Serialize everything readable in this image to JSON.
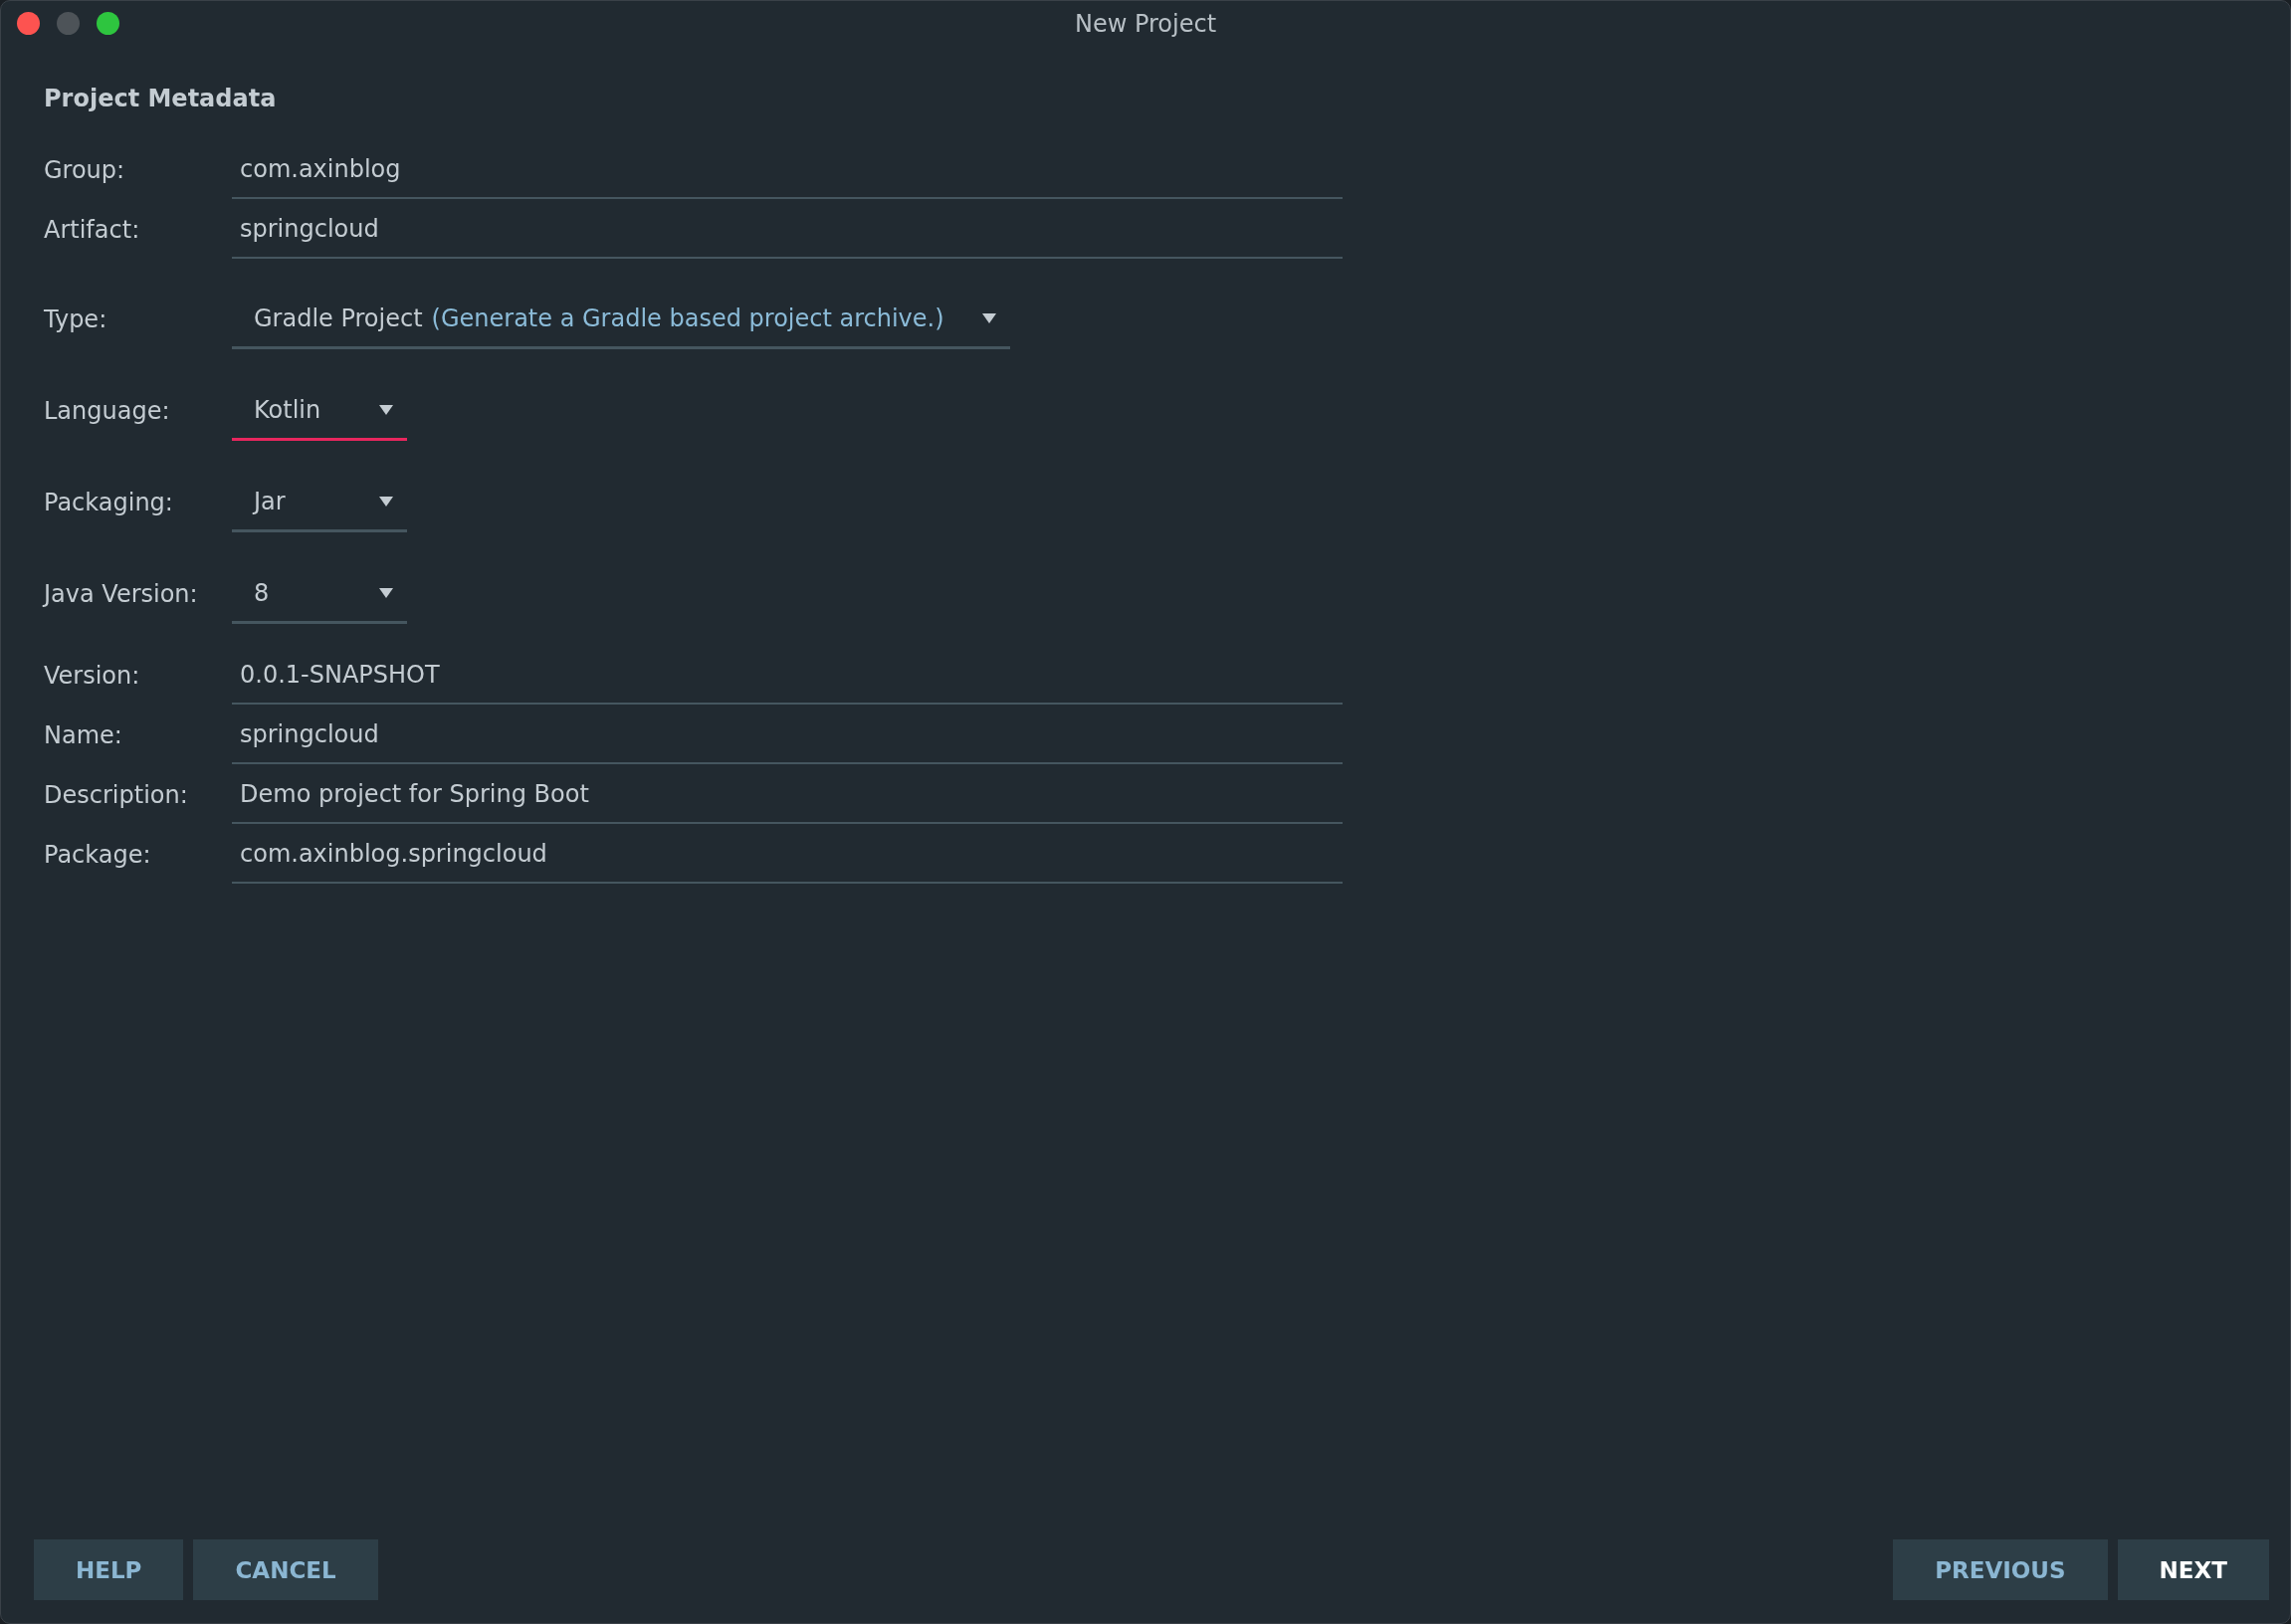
{
  "window": {
    "title": "New Project"
  },
  "section_title": "Project Metadata",
  "fields": [
    {
      "kind": "text",
      "label": "Group:",
      "value": "com.axinblog"
    },
    {
      "kind": "text",
      "label": "Artifact:",
      "value": "springcloud"
    },
    {
      "kind": "dropdown",
      "label": "Type:",
      "value": "Gradle Project",
      "hint": "(Generate a Gradle based project archive.)",
      "focused": false
    },
    {
      "kind": "dropdown",
      "label": "Language:",
      "value": "Kotlin",
      "focused": true
    },
    {
      "kind": "dropdown",
      "label": "Packaging:",
      "value": "Jar",
      "focused": false
    },
    {
      "kind": "dropdown",
      "label": "Java Version:",
      "value": "8",
      "focused": false
    },
    {
      "kind": "text",
      "label": "Version:",
      "value": "0.0.1-SNAPSHOT"
    },
    {
      "kind": "text",
      "label": "Name:",
      "value": "springcloud"
    },
    {
      "kind": "text",
      "label": "Description:",
      "value": "Demo project for Spring Boot"
    },
    {
      "kind": "text",
      "label": "Package:",
      "value": "com.axinblog.springcloud"
    }
  ],
  "buttons_left": [
    {
      "label": "HELP",
      "primary": false
    },
    {
      "label": "CANCEL",
      "primary": false
    }
  ],
  "buttons_right": [
    {
      "label": "PREVIOUS",
      "primary": false
    },
    {
      "label": "NEXT",
      "primary": true
    }
  ]
}
